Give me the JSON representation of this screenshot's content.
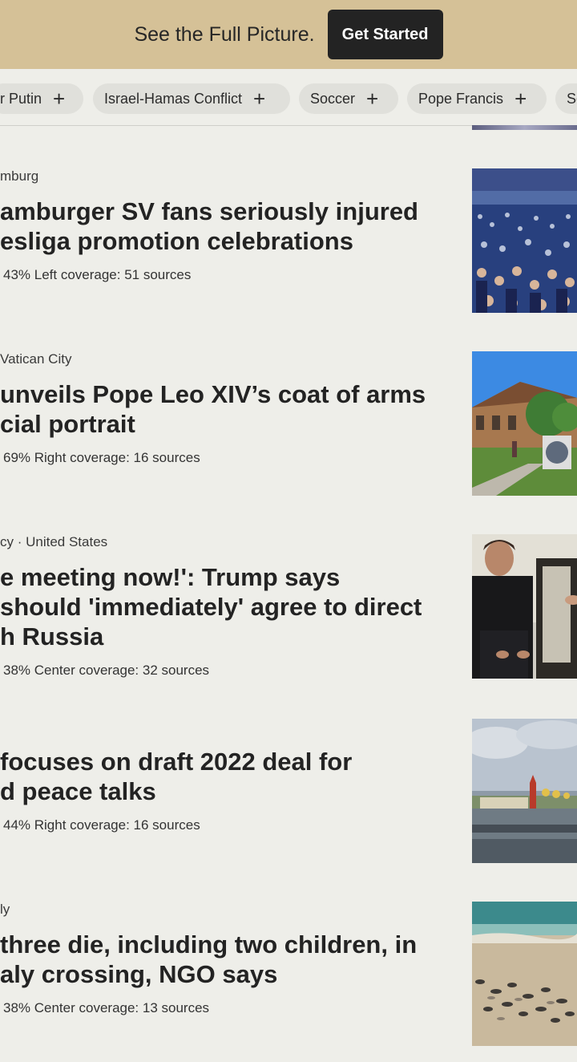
{
  "banner": {
    "text": "See the Full Picture.",
    "cta": "Get Started"
  },
  "chips": [
    {
      "label": "r Putin",
      "icon": "plus-icon"
    },
    {
      "label": "Israel-Hamas Conflict",
      "icon": "plus-icon"
    },
    {
      "label": "Soccer",
      "icon": "plus-icon"
    },
    {
      "label": "Pope Francis",
      "icon": "plus-icon"
    },
    {
      "label": "Sc",
      "icon": "plus-icon"
    }
  ],
  "plus_symbol": "+",
  "stories": [
    {
      "meta": "mburg",
      "headline_lines": [
        "amburger SV fans seriously injured",
        "esliga promotion celebrations"
      ],
      "coverage": "43% Left coverage: 51 sources",
      "image": "stadium-crowd-photo"
    },
    {
      "meta": "Vatican City",
      "headline_lines": [
        "unveils Pope Leo XIV’s coat of arms",
        "cial portrait"
      ],
      "coverage": "69% Right coverage: 16 sources",
      "image": "church-building-photo"
    },
    {
      "meta": "cy · United States",
      "headline_lines": [
        "e meeting now!': Trump says",
        "should 'immediately' agree to direct",
        "h Russia"
      ],
      "coverage": "38% Center coverage: 32 sources",
      "image": "seated-leader-photo"
    },
    {
      "meta": "",
      "headline_lines": [
        "focuses on draft 2022 deal for",
        "d peace talks"
      ],
      "coverage": "44% Right coverage: 16 sources",
      "image": "kremlin-river-photo"
    },
    {
      "meta": "ly",
      "headline_lines": [
        "three die, including two children, in",
        "aly crossing, NGO says"
      ],
      "coverage": "38% Center coverage: 13 sources",
      "image": "beach-shoes-photo"
    }
  ]
}
